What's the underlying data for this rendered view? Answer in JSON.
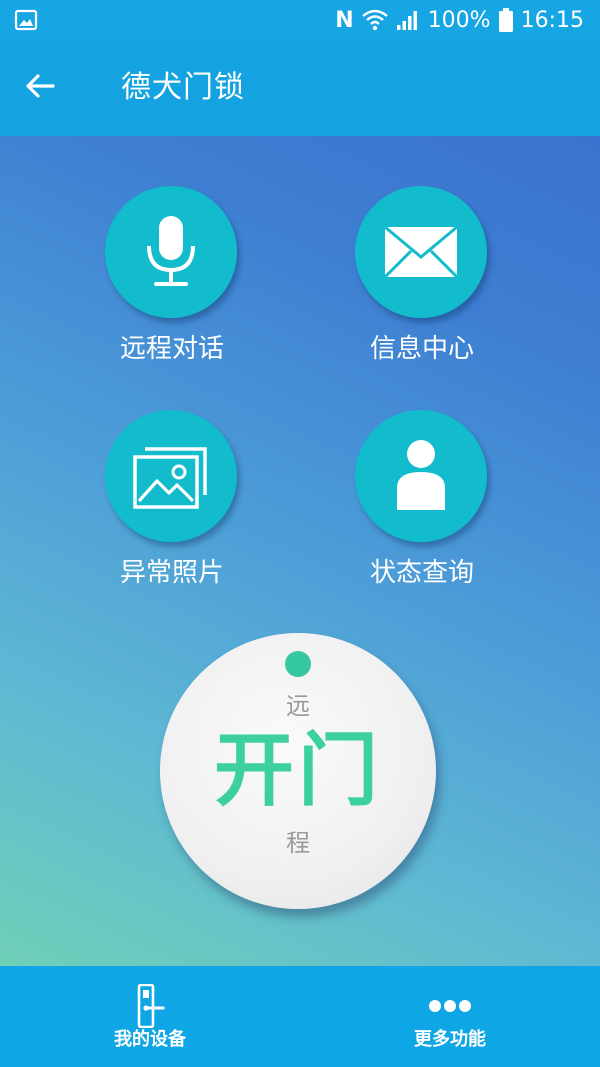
{
  "status_bar": {
    "battery": "100%",
    "time": "16:15",
    "nfc": "N"
  },
  "app_bar": {
    "title": "德犬门锁"
  },
  "features": [
    {
      "label": "远程对话",
      "icon": "microphone-icon"
    },
    {
      "label": "信息中心",
      "icon": "envelope-icon"
    },
    {
      "label": "异常照片",
      "icon": "photos-icon"
    },
    {
      "label": "状态查询",
      "icon": "person-icon"
    }
  ],
  "unlock": {
    "top_char": "远",
    "main": "开门",
    "bottom_char": "程"
  },
  "bottom_nav": {
    "items": [
      {
        "label": "我的设备",
        "icon": "door-lock-icon"
      },
      {
        "label": "更多功能",
        "icon": "more-dots-icon"
      }
    ]
  },
  "colors": {
    "accent": "#14a3e0",
    "feature_circle": "#12bccc",
    "unlock_text": "#3bd09c"
  }
}
